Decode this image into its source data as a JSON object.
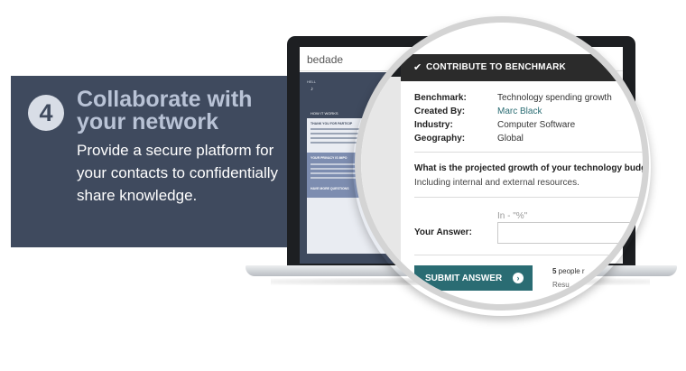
{
  "step": {
    "number": "4",
    "title": "Collaborate with your network",
    "description": "Provide a secure platform for your contacts to confidentially share knowledge."
  },
  "screen": {
    "brand": "bedade",
    "nav_hello": "HELL",
    "nav_icon": "♪",
    "card_head": "HOW IT WORKS",
    "card_sub1": "THANK YOU FOR PARTICIP",
    "card_sub2": "YOUR PRIVACY IS IMPO",
    "card_sub3": "HAVE MORE QUESTIONS"
  },
  "benchmark": {
    "header": "CONTRIBUTE TO BENCHMARK",
    "header_icon": "check-icon",
    "fields": [
      {
        "label": "Benchmark:",
        "value": "Technology spending growth"
      },
      {
        "label": "Created By:",
        "value": "Marc Black"
      },
      {
        "label": "Industry:",
        "value": "Computer Software"
      },
      {
        "label": "Geography:",
        "value": "Global"
      }
    ],
    "question": "What is the projected growth of your technology budge",
    "question_sub": "Including internal and external resources.",
    "answer_hint": "In - \"%\"",
    "answer_label": "Your Answer:",
    "answer_value": "",
    "submit_label": "SUBMIT ANSWER",
    "submit_icon": "arrow-right-circle-icon",
    "people_count": "5",
    "people_text": " people r",
    "results_text": "Resu"
  },
  "colors": {
    "panel": "#3f4a5e",
    "title": "#b9c3d6",
    "accent": "#2a6c73",
    "header": "#2b2b2b"
  }
}
